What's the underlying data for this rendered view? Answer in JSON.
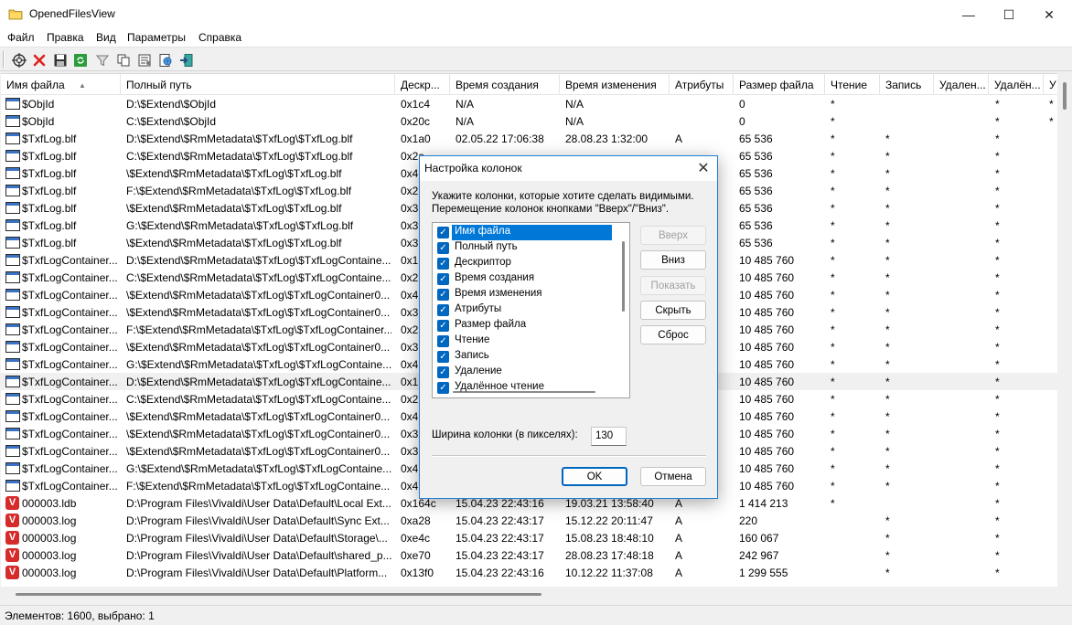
{
  "window": {
    "title": "OpenedFilesView",
    "min_glyph": "—",
    "max_glyph": "☐",
    "close_glyph": "✕"
  },
  "menu": [
    "Файл",
    "Правка",
    "Вид",
    "Параметры",
    "Справка"
  ],
  "toolbar": {
    "buttons": [
      "target-icon",
      "delete-icon",
      "save-icon",
      "refresh-icon",
      "filter-icon",
      "copy-icon",
      "properties-icon",
      "html-report-icon",
      "exit-icon"
    ]
  },
  "columns": [
    "Имя файла",
    "Полный путь",
    "Дескр...",
    "Время создания",
    "Время изменения",
    "Атрибуты",
    "Размер файла",
    "Чтение",
    "Запись",
    "Удален...",
    "Удалён...",
    "У"
  ],
  "rows": [
    {
      "icon": "file",
      "name": "$ObjId",
      "path": "D:\\$Extend\\$ObjId",
      "handle": "0x1c4",
      "created": "N/A",
      "modified": "N/A",
      "attr": "",
      "size": "0",
      "read": "*",
      "write": "",
      "del": "",
      "del2": "*",
      "u": "*"
    },
    {
      "icon": "file",
      "name": "$ObjId",
      "path": "C:\\$Extend\\$ObjId",
      "handle": "0x20c",
      "created": "N/A",
      "modified": "N/A",
      "attr": "",
      "size": "0",
      "read": "*",
      "write": "",
      "del": "",
      "del2": "*",
      "u": "*"
    },
    {
      "icon": "file",
      "name": "$TxfLog.blf",
      "path": "D:\\$Extend\\$RmMetadata\\$TxfLog\\$TxfLog.blf",
      "handle": "0x1a0",
      "created": "02.05.22 17:06:38",
      "modified": "28.08.23 1:32:00",
      "attr": "A",
      "size": "65 536",
      "read": "*",
      "write": "*",
      "del": "",
      "del2": "*",
      "u": ""
    },
    {
      "icon": "file",
      "name": "$TxfLog.blf",
      "path": "C:\\$Extend\\$RmMetadata\\$TxfLog\\$TxfLog.blf",
      "handle": "0x2a",
      "created": "",
      "modified": "",
      "attr": "",
      "size": "65 536",
      "read": "*",
      "write": "*",
      "del": "",
      "del2": "*",
      "u": ""
    },
    {
      "icon": "file",
      "name": "$TxfLog.blf",
      "path": "\\$Extend\\$RmMetadata\\$TxfLog\\$TxfLog.blf",
      "handle": "0x4",
      "created": "",
      "modified": "",
      "attr": "",
      "size": "65 536",
      "read": "*",
      "write": "*",
      "del": "",
      "del2": "*",
      "u": ""
    },
    {
      "icon": "file",
      "name": "$TxfLog.blf",
      "path": "F:\\$Extend\\$RmMetadata\\$TxfLog\\$TxfLog.blf",
      "handle": "0x2",
      "created": "",
      "modified": "",
      "attr": "",
      "size": "65 536",
      "read": "*",
      "write": "*",
      "del": "",
      "del2": "*",
      "u": ""
    },
    {
      "icon": "file",
      "name": "$TxfLog.blf",
      "path": "\\$Extend\\$RmMetadata\\$TxfLog\\$TxfLog.blf",
      "handle": "0x3",
      "created": "",
      "modified": "",
      "attr": "",
      "size": "65 536",
      "read": "*",
      "write": "*",
      "del": "",
      "del2": "*",
      "u": ""
    },
    {
      "icon": "file",
      "name": "$TxfLog.blf",
      "path": "G:\\$Extend\\$RmMetadata\\$TxfLog\\$TxfLog.blf",
      "handle": "0x3",
      "created": "",
      "modified": "",
      "attr": "",
      "size": "65 536",
      "read": "*",
      "write": "*",
      "del": "",
      "del2": "*",
      "u": ""
    },
    {
      "icon": "file",
      "name": "$TxfLog.blf",
      "path": "\\$Extend\\$RmMetadata\\$TxfLog\\$TxfLog.blf",
      "handle": "0x3",
      "created": "",
      "modified": "",
      "attr": "",
      "size": "65 536",
      "read": "*",
      "write": "*",
      "del": "",
      "del2": "*",
      "u": ""
    },
    {
      "icon": "file",
      "name": "$TxfLogContainer...",
      "path": "D:\\$Extend\\$RmMetadata\\$TxfLog\\$TxfLogContaine...",
      "handle": "0x1",
      "created": "",
      "modified": "",
      "attr": "",
      "size": "10 485 760",
      "read": "*",
      "write": "*",
      "del": "",
      "del2": "*",
      "u": ""
    },
    {
      "icon": "file",
      "name": "$TxfLogContainer...",
      "path": "C:\\$Extend\\$RmMetadata\\$TxfLog\\$TxfLogContaine...",
      "handle": "0x2",
      "created": "",
      "modified": "",
      "attr": "",
      "size": "10 485 760",
      "read": "*",
      "write": "*",
      "del": "",
      "del2": "*",
      "u": ""
    },
    {
      "icon": "file",
      "name": "$TxfLogContainer...",
      "path": "\\$Extend\\$RmMetadata\\$TxfLog\\$TxfLogContainer0...",
      "handle": "0x4",
      "created": "",
      "modified": "",
      "attr": "",
      "size": "10 485 760",
      "read": "*",
      "write": "*",
      "del": "",
      "del2": "*",
      "u": ""
    },
    {
      "icon": "file",
      "name": "$TxfLogContainer...",
      "path": "\\$Extend\\$RmMetadata\\$TxfLog\\$TxfLogContainer0...",
      "handle": "0x3",
      "created": "",
      "modified": "",
      "attr": "",
      "size": "10 485 760",
      "read": "*",
      "write": "*",
      "del": "",
      "del2": "*",
      "u": ""
    },
    {
      "icon": "file",
      "name": "$TxfLogContainer...",
      "path": "F:\\$Extend\\$RmMetadata\\$TxfLog\\$TxfLogContainer...",
      "handle": "0x2",
      "created": "",
      "modified": "",
      "attr": "",
      "size": "10 485 760",
      "read": "*",
      "write": "*",
      "del": "",
      "del2": "*",
      "u": ""
    },
    {
      "icon": "file",
      "name": "$TxfLogContainer...",
      "path": "\\$Extend\\$RmMetadata\\$TxfLog\\$TxfLogContainer0...",
      "handle": "0x3",
      "created": "",
      "modified": "",
      "attr": "",
      "size": "10 485 760",
      "read": "*",
      "write": "*",
      "del": "",
      "del2": "*",
      "u": ""
    },
    {
      "icon": "file",
      "name": "$TxfLogContainer...",
      "path": "G:\\$Extend\\$RmMetadata\\$TxfLog\\$TxfLogContaine...",
      "handle": "0x4",
      "created": "",
      "modified": "",
      "attr": "",
      "size": "10 485 760",
      "read": "*",
      "write": "*",
      "del": "",
      "del2": "*",
      "u": ""
    },
    {
      "icon": "file",
      "name": "$TxfLogContainer...",
      "path": "D:\\$Extend\\$RmMetadata\\$TxfLog\\$TxfLogContaine...",
      "handle": "0x1",
      "created": "",
      "modified": "",
      "attr": "",
      "size": "10 485 760",
      "read": "*",
      "write": "*",
      "del": "",
      "del2": "*",
      "u": "",
      "highlight": true
    },
    {
      "icon": "file",
      "name": "$TxfLogContainer...",
      "path": "C:\\$Extend\\$RmMetadata\\$TxfLog\\$TxfLogContaine...",
      "handle": "0x2",
      "created": "",
      "modified": "",
      "attr": "",
      "size": "10 485 760",
      "read": "*",
      "write": "*",
      "del": "",
      "del2": "*",
      "u": ""
    },
    {
      "icon": "file",
      "name": "$TxfLogContainer...",
      "path": "\\$Extend\\$RmMetadata\\$TxfLog\\$TxfLogContainer0...",
      "handle": "0x4",
      "created": "",
      "modified": "",
      "attr": "",
      "size": "10 485 760",
      "read": "*",
      "write": "*",
      "del": "",
      "del2": "*",
      "u": ""
    },
    {
      "icon": "file",
      "name": "$TxfLogContainer...",
      "path": "\\$Extend\\$RmMetadata\\$TxfLog\\$TxfLogContainer0...",
      "handle": "0x3",
      "created": "",
      "modified": "",
      "attr": "",
      "size": "10 485 760",
      "read": "*",
      "write": "*",
      "del": "",
      "del2": "*",
      "u": ""
    },
    {
      "icon": "file",
      "name": "$TxfLogContainer...",
      "path": "\\$Extend\\$RmMetadata\\$TxfLog\\$TxfLogContainer0...",
      "handle": "0x3",
      "created": "",
      "modified": "",
      "attr": "",
      "size": "10 485 760",
      "read": "*",
      "write": "*",
      "del": "",
      "del2": "*",
      "u": ""
    },
    {
      "icon": "file",
      "name": "$TxfLogContainer...",
      "path": "G:\\$Extend\\$RmMetadata\\$TxfLog\\$TxfLogContaine...",
      "handle": "0x4",
      "created": "",
      "modified": "",
      "attr": "",
      "size": "10 485 760",
      "read": "*",
      "write": "*",
      "del": "",
      "del2": "*",
      "u": ""
    },
    {
      "icon": "file",
      "name": "$TxfLogContainer...",
      "path": "F:\\$Extend\\$RmMetadata\\$TxfLog\\$TxfLogContaine...",
      "handle": "0x4",
      "created": "",
      "modified": "",
      "attr": "",
      "size": "10 485 760",
      "read": "*",
      "write": "*",
      "del": "",
      "del2": "*",
      "u": ""
    },
    {
      "icon": "vivaldi",
      "name": "000003.ldb",
      "path": "D:\\Program Files\\Vivaldi\\User Data\\Default\\Local Ext...",
      "handle": "0x164c",
      "created": "15.04.23 22:43:16",
      "modified": "19.03.21 13:58:40",
      "attr": "A",
      "size": "1 414 213",
      "read": "*",
      "write": "",
      "del": "",
      "del2": "*",
      "u": ""
    },
    {
      "icon": "vivaldi",
      "name": "000003.log",
      "path": "D:\\Program Files\\Vivaldi\\User Data\\Default\\Sync Ext...",
      "handle": "0xa28",
      "created": "15.04.23 22:43:17",
      "modified": "15.12.22 20:11:47",
      "attr": "A",
      "size": "220",
      "read": "",
      "write": "*",
      "del": "",
      "del2": "*",
      "u": ""
    },
    {
      "icon": "vivaldi",
      "name": "000003.log",
      "path": "D:\\Program Files\\Vivaldi\\User Data\\Default\\Storage\\...",
      "handle": "0xe4c",
      "created": "15.04.23 22:43:17",
      "modified": "15.08.23 18:48:10",
      "attr": "A",
      "size": "160 067",
      "read": "",
      "write": "*",
      "del": "",
      "del2": "*",
      "u": ""
    },
    {
      "icon": "vivaldi",
      "name": "000003.log",
      "path": "D:\\Program Files\\Vivaldi\\User Data\\Default\\shared_p...",
      "handle": "0xe70",
      "created": "15.04.23 22:43:17",
      "modified": "28.08.23 17:48:18",
      "attr": "A",
      "size": "242 967",
      "read": "",
      "write": "*",
      "del": "",
      "del2": "*",
      "u": ""
    },
    {
      "icon": "vivaldi",
      "name": "000003.log",
      "path": "D:\\Program Files\\Vivaldi\\User Data\\Default\\Platform...",
      "handle": "0x13f0",
      "created": "15.04.23 22:43:16",
      "modified": "10.12.22 11:37:08",
      "attr": "A",
      "size": "1 299 555",
      "read": "",
      "write": "*",
      "del": "",
      "del2": "*",
      "u": ""
    }
  ],
  "status": "Элементов: 1600, выбрано: 1",
  "dialog": {
    "title": "Настройка колонок",
    "close_glyph": "✕",
    "instruction_line1": "Укажите колонки, которые хотите сделать видимыми.",
    "instruction_line2": "Перемещение колонок кнопками \"Вверх\"/\"Вниз\".",
    "column_items": [
      "Имя файла",
      "Полный путь",
      "Дескриптор",
      "Время создания",
      "Время изменения",
      "Атрибуты",
      "Размер файла",
      "Чтение",
      "Запись",
      "Удаление",
      "Удалённое чтение"
    ],
    "selected_item": "Имя файла",
    "buttons": {
      "up": "Вверх",
      "down": "Вниз",
      "show": "Показать",
      "hide": "Скрыть",
      "reset": "Сброс"
    },
    "width_label": "Ширина колонки (в пикселях):",
    "width_value": "130",
    "ok": "OK",
    "cancel": "Отмена"
  }
}
